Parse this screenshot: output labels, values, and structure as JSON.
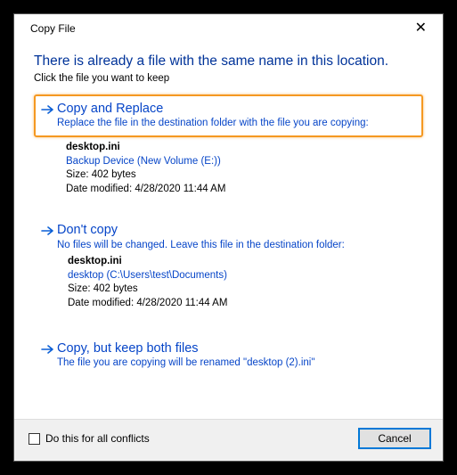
{
  "titlebar": {
    "title": "Copy File",
    "close_glyph": "✕"
  },
  "heading": "There is already a file with the same name in this location.",
  "subheading": "Click the file you want to keep",
  "options": [
    {
      "title": "Copy and Replace",
      "desc": "Replace the file in the destination folder with the file you are copying:",
      "file": {
        "name": "desktop.ini",
        "path": "Backup Device (New Volume (E:))",
        "size": "Size: 402 bytes",
        "modified": "Date modified: 4/28/2020 11:44 AM"
      }
    },
    {
      "title": "Don't copy",
      "desc": "No files will be changed. Leave this file in the destination folder:",
      "file": {
        "name": "desktop.ini",
        "path": "desktop (C:\\Users\\test\\Documents)",
        "size": "Size: 402 bytes",
        "modified": "Date modified: 4/28/2020 11:44 AM"
      }
    },
    {
      "title": "Copy, but keep both files",
      "desc": "The file you are copying will be renamed \"desktop (2).ini\""
    }
  ],
  "footer": {
    "checkbox_label": "Do this for all conflicts",
    "cancel_label": "Cancel"
  }
}
